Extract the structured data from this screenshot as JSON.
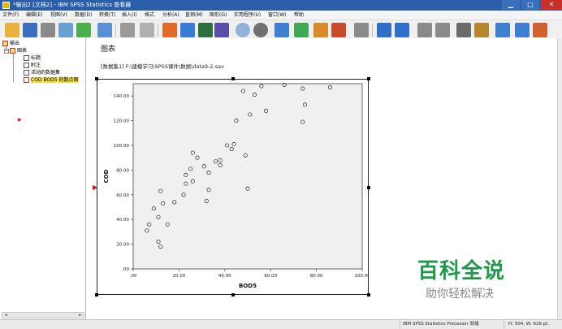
{
  "window": {
    "title": "*输出2 [文档2] - IBM SPSS Statistics 查看器",
    "min_glyph": "▁",
    "max_glyph": "□",
    "close_glyph": "✕"
  },
  "menu": [
    "文件(F)",
    "编辑(E)",
    "视图(V)",
    "数据(D)",
    "转换(T)",
    "插入(I)",
    "格式",
    "分析(A)",
    "直销(M)",
    "图形(G)",
    "实用程序(U)",
    "窗口(W)",
    "帮助"
  ],
  "outline": {
    "nodes": [
      {
        "label": "输出",
        "level": 0
      },
      {
        "label": "图表",
        "level": 1
      },
      {
        "label": "标题",
        "level": 2
      },
      {
        "label": "附注",
        "level": 2
      },
      {
        "label": "活动的数据集",
        "level": 2
      },
      {
        "label": "COD BOD5 的散点图",
        "level": 2,
        "selected": true
      }
    ],
    "collapse_glyph": "−",
    "scroll_left": "◄",
    "scroll_right": "►"
  },
  "content": {
    "heading": "图表",
    "filepath": "[数据集1] F:\\建模学习\\SPSS课件\\数据\\data9-2.sav",
    "anchor": "▶"
  },
  "chart_data": {
    "type": "scatter",
    "xlabel": "BOD5",
    "ylabel": "COD",
    "xlim": [
      0,
      100
    ],
    "ylim": [
      0,
      150
    ],
    "x_ticks": [
      0,
      20,
      40,
      60,
      80,
      100
    ],
    "x_tick_labels": [
      ".00",
      "20.00",
      "40.00",
      "60.00",
      "80.00",
      "100.00"
    ],
    "y_ticks": [
      0,
      20,
      40,
      60,
      80,
      100,
      120,
      140
    ],
    "y_tick_labels": [
      ".00",
      "20.00",
      "40.00",
      "60.00",
      "80.00",
      "100.00",
      "120.00",
      "140.00"
    ],
    "marker": "open-circle",
    "plot_bg": "#f0f0f0",
    "points": [
      {
        "x": 6,
        "y": 31
      },
      {
        "x": 7,
        "y": 36
      },
      {
        "x": 9,
        "y": 49
      },
      {
        "x": 11,
        "y": 42
      },
      {
        "x": 11,
        "y": 22
      },
      {
        "x": 12,
        "y": 18
      },
      {
        "x": 12,
        "y": 63
      },
      {
        "x": 13,
        "y": 53
      },
      {
        "x": 15,
        "y": 36
      },
      {
        "x": 18,
        "y": 54
      },
      {
        "x": 22,
        "y": 60
      },
      {
        "x": 23,
        "y": 69
      },
      {
        "x": 23,
        "y": 76
      },
      {
        "x": 25,
        "y": 81
      },
      {
        "x": 26,
        "y": 71
      },
      {
        "x": 26,
        "y": 94
      },
      {
        "x": 28,
        "y": 90
      },
      {
        "x": 31,
        "y": 83
      },
      {
        "x": 32,
        "y": 55
      },
      {
        "x": 33,
        "y": 64
      },
      {
        "x": 33,
        "y": 78
      },
      {
        "x": 36,
        "y": 87
      },
      {
        "x": 38,
        "y": 84
      },
      {
        "x": 38,
        "y": 88
      },
      {
        "x": 41,
        "y": 100
      },
      {
        "x": 43,
        "y": 97
      },
      {
        "x": 44,
        "y": 101
      },
      {
        "x": 45,
        "y": 120
      },
      {
        "x": 48,
        "y": 144
      },
      {
        "x": 49,
        "y": 92
      },
      {
        "x": 50,
        "y": 65
      },
      {
        "x": 51,
        "y": 125
      },
      {
        "x": 53,
        "y": 141
      },
      {
        "x": 56,
        "y": 148
      },
      {
        "x": 58,
        "y": 128
      },
      {
        "x": 66,
        "y": 149
      },
      {
        "x": 74,
        "y": 146
      },
      {
        "x": 75,
        "y": 133
      },
      {
        "x": 74,
        "y": 119
      },
      {
        "x": 86,
        "y": 147
      }
    ]
  },
  "status": {
    "processor": "IBM SPSS Statistics Processor 就绪",
    "size": "H: 504, W: 629 pt."
  },
  "watermark": {
    "main": "百科全说",
    "sub": "助你轻松解决"
  },
  "colors": {
    "titlebar": "#2a5ea8",
    "selection": "#f6e04a",
    "watermark_green": "#1f9a4a"
  }
}
